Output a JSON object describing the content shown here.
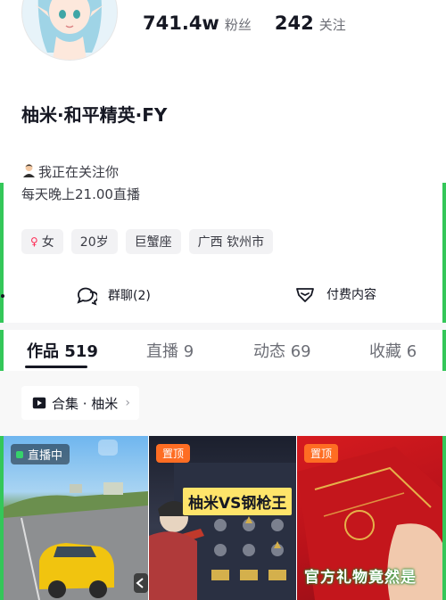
{
  "profile": {
    "followers_count": "741.4w",
    "followers_label": "粉丝",
    "following_count": "242",
    "following_label": "关注",
    "nickname": "柚米·和平精英·FY",
    "follow_status": "我正在关注你",
    "bio": "每天晚上21.00直播",
    "tags": [
      "女",
      "20岁",
      "巨蟹座",
      "广西 钦州市"
    ]
  },
  "actions": {
    "group_chat": "群聊(2)",
    "paid_content": "付费内容"
  },
  "tabs": [
    {
      "label": "作品",
      "count": "519"
    },
    {
      "label": "直播",
      "count": "9"
    },
    {
      "label": "动态",
      "count": "69"
    },
    {
      "label": "收藏",
      "count": "6"
    }
  ],
  "collection": {
    "label": "合集 · 柚米"
  },
  "videos": [
    {
      "badge": "直播中"
    },
    {
      "badge": "置顶",
      "overlay_title": "柚米VS钢枪王"
    },
    {
      "badge": "置顶",
      "caption": "官方礼物竟然是"
    }
  ],
  "colors": {
    "accent": "#fe2c55",
    "live_green": "#36d26b",
    "pin_orange": "#fe6d23",
    "edge_green": "#34c759"
  },
  "icons": {
    "group": "chat-bubbles-icon",
    "paid": "gem-icon",
    "collection": "play-square-icon",
    "chevron": "chevron-right-icon"
  }
}
